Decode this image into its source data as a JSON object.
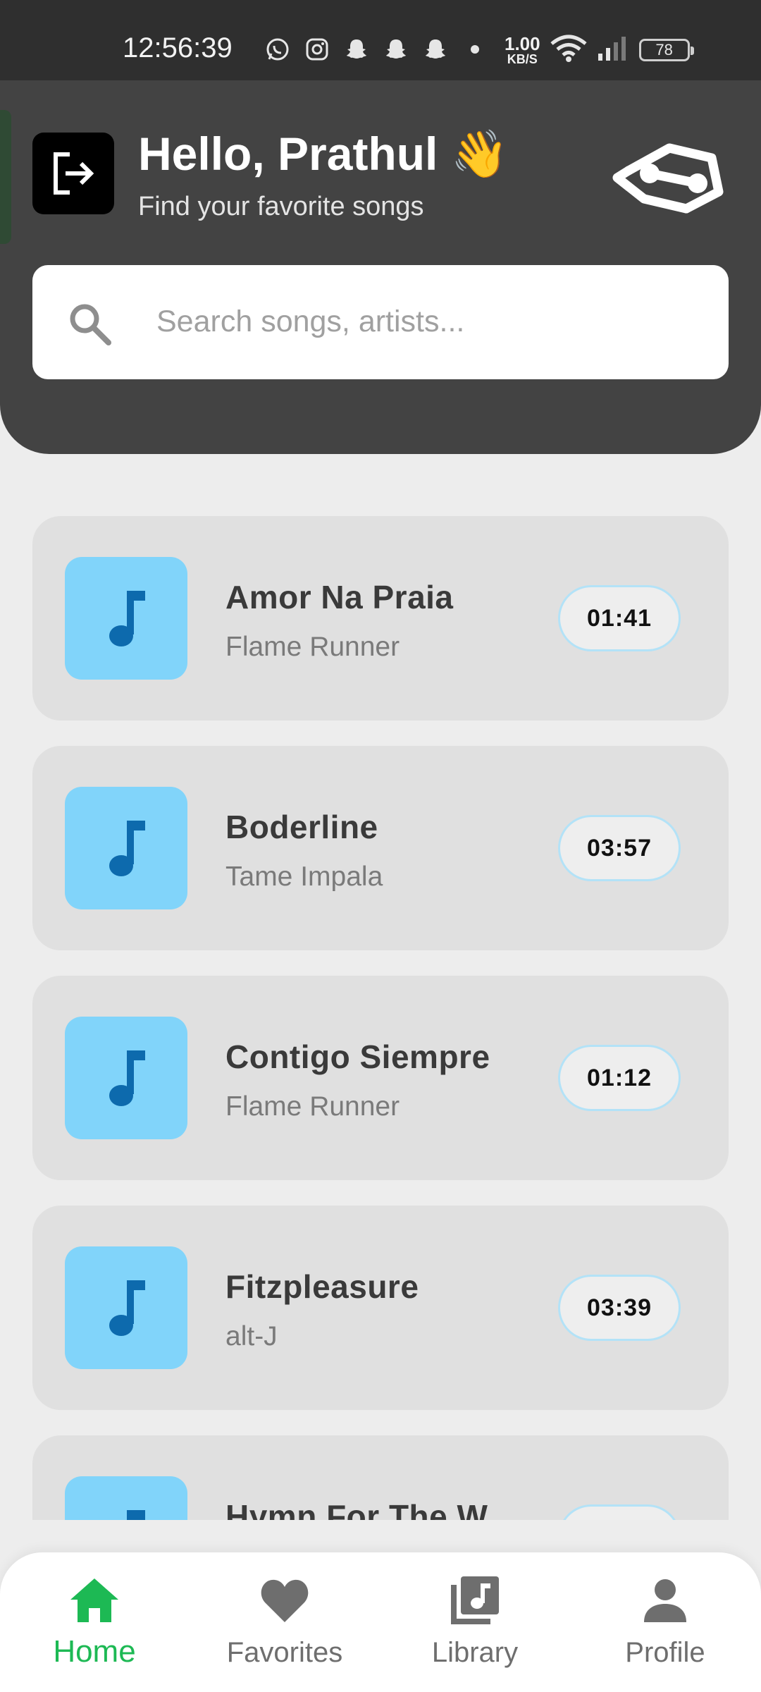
{
  "status_bar": {
    "time": "12:56:39",
    "net_speed_value": "1.00",
    "net_speed_unit": "KB/S",
    "battery": "78",
    "icons": [
      "whatsapp-icon",
      "instagram-icon",
      "snapchat-icon",
      "snapchat-icon",
      "snapchat-icon",
      "dot-icon",
      "wifi-icon",
      "signal-icon",
      "battery-icon"
    ]
  },
  "header": {
    "greeting": "Hello, Prathul 👋",
    "subtitle": "Find your favorite songs",
    "logout_icon": "logout-icon",
    "logo_icon": "app-logo-icon"
  },
  "search": {
    "placeholder": "Search songs, artists...",
    "value": ""
  },
  "songs": [
    {
      "title": "Amor Na Praia",
      "artist": "Flame Runner",
      "duration": "01:41"
    },
    {
      "title": "Boderline",
      "artist": "Tame Impala",
      "duration": "03:57"
    },
    {
      "title": "Contigo Siempre",
      "artist": "Flame Runner",
      "duration": "01:12"
    },
    {
      "title": "Fitzpleasure",
      "artist": "alt-J",
      "duration": "03:39"
    },
    {
      "title": "Hymn For The W",
      "artist": "",
      "duration": ""
    }
  ],
  "nav": {
    "items": [
      {
        "label": "Home",
        "icon": "home-icon",
        "active": true
      },
      {
        "label": "Favorites",
        "icon": "heart-icon",
        "active": false
      },
      {
        "label": "Library",
        "icon": "library-music-icon",
        "active": false
      },
      {
        "label": "Profile",
        "icon": "person-icon",
        "active": false
      }
    ]
  },
  "colors": {
    "header_bg": "#434343",
    "accent_green": "#1db954",
    "album_art_bg": "#81d4fa",
    "music_note": "#0d6aad",
    "card_bg": "#e0e0e0"
  }
}
